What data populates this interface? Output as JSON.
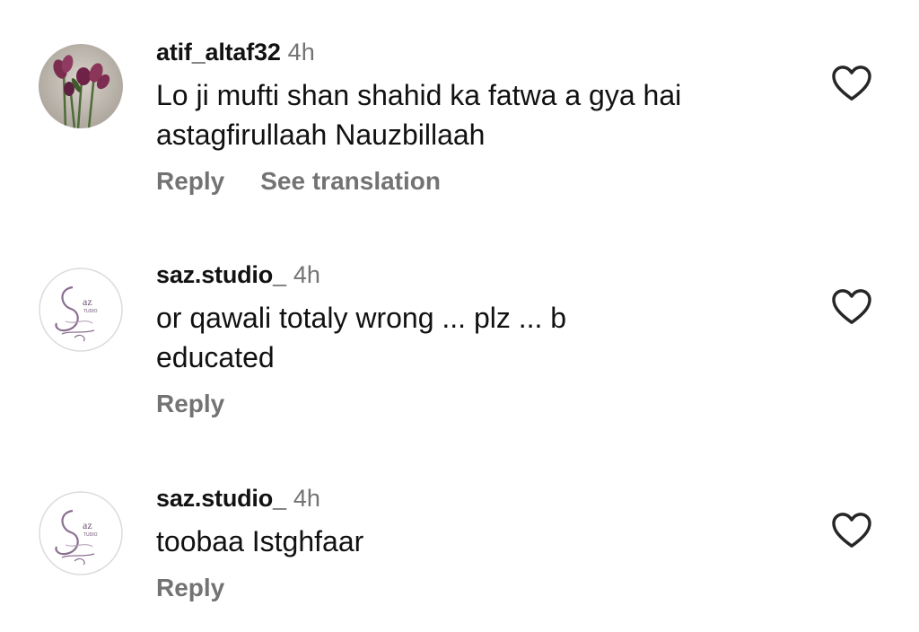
{
  "comments": [
    {
      "username": "atif_altaf32",
      "time": "4h",
      "text_lines": [
        "Lo ji mufti shan shahid ka fatwa a gya hai",
        "astagfirullaah Nauzbillaah"
      ],
      "reply_label": "Reply",
      "translation_label": "See translation",
      "avatar_icon": "tulips-photo-avatar",
      "like_icon": "heart-outline-icon"
    },
    {
      "username": "saz.studio_",
      "time": "4h",
      "text_lines": [
        "or qawali totaly wrong ... plz ... b",
        "educated"
      ],
      "reply_label": "Reply",
      "avatar_logo_text": "az",
      "avatar_logo_subtext": "TUDIO",
      "avatar_icon": "saz-studio-logo-avatar",
      "like_icon": "heart-outline-icon"
    },
    {
      "username": "saz.studio_",
      "time": "4h",
      "text_lines": [
        "toobaa Istghfaar"
      ],
      "reply_label": "Reply",
      "avatar_logo_text": "az",
      "avatar_logo_subtext": "TUDIO",
      "avatar_icon": "saz-studio-logo-avatar",
      "like_icon": "heart-outline-icon"
    }
  ],
  "colors": {
    "username": "#121212",
    "secondary_text": "#737373",
    "body_text": "#111111",
    "logo_purple": "#8a6f8f"
  }
}
